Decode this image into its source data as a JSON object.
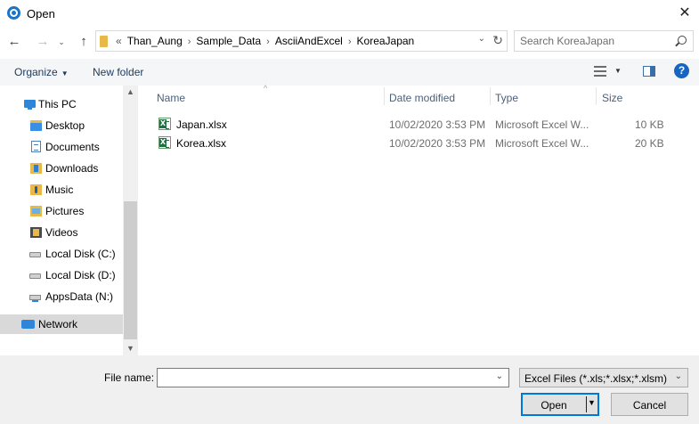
{
  "window": {
    "title": "Open",
    "close_glyph": "✕"
  },
  "nav": {
    "back_glyph": "←",
    "forward_glyph": "→",
    "recent_glyph": "⌄",
    "up_glyph": "↑",
    "overflow_glyph": "«",
    "breadcrumbs": [
      "Than_Aung",
      "Sample_Data",
      "AsciiAndExcel",
      "KoreaJapan"
    ],
    "separator_glyph": "›",
    "dropdown_glyph": "⌄",
    "refresh_glyph": "↻"
  },
  "search": {
    "placeholder": "Search KoreaJapan"
  },
  "toolbar": {
    "organize_label": "Organize",
    "organize_caret": "▼",
    "new_folder_label": "New folder",
    "views_caret": "▼",
    "help_label": "?"
  },
  "sidebar": {
    "scroll_up_glyph": "▲",
    "scroll_down_glyph": "▼",
    "items": [
      {
        "label": "This PC",
        "icon": "computer-icon"
      },
      {
        "label": "Desktop",
        "icon": "desktop-folder-icon"
      },
      {
        "label": "Documents",
        "icon": "documents-folder-icon"
      },
      {
        "label": "Downloads",
        "icon": "downloads-folder-icon"
      },
      {
        "label": "Music",
        "icon": "music-folder-icon"
      },
      {
        "label": "Pictures",
        "icon": "pictures-folder-icon"
      },
      {
        "label": "Videos",
        "icon": "videos-folder-icon"
      },
      {
        "label": "Local Disk (C:)",
        "icon": "disk-icon"
      },
      {
        "label": "Local Disk (D:)",
        "icon": "disk-icon"
      },
      {
        "label": "AppsData (N:)",
        "icon": "network-drive-icon"
      },
      {
        "label": "Network",
        "icon": "network-icon",
        "selected": true
      }
    ]
  },
  "files": {
    "sort_glyph": "^",
    "columns": {
      "name": "Name",
      "date": "Date modified",
      "type": "Type",
      "size": "Size"
    },
    "rows": [
      {
        "name": "Japan.xlsx",
        "date": "10/02/2020 3:53 PM",
        "type": "Microsoft Excel W...",
        "size": "10 KB",
        "icon": "excel-file-icon"
      },
      {
        "name": "Korea.xlsx",
        "date": "10/02/2020 3:53 PM",
        "type": "Microsoft Excel W...",
        "size": "20 KB",
        "icon": "excel-file-icon"
      }
    ]
  },
  "footer": {
    "file_name_label": "File name:",
    "file_name_value": "",
    "combo_caret": "⌄",
    "filter_label": "Excel Files (*.xls;*.xlsx;*.xlsm)",
    "open_label": "Open",
    "open_caret": "▼",
    "cancel_label": "Cancel"
  }
}
